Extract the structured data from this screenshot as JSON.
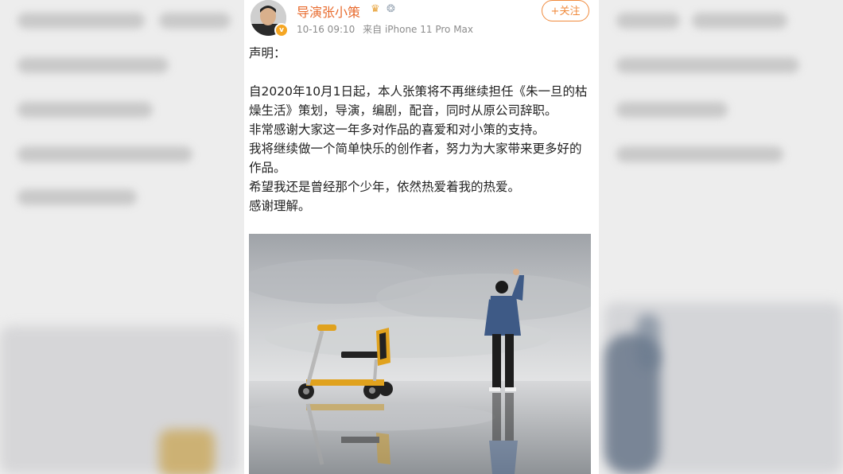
{
  "post": {
    "username": "导演张小策",
    "vip_icons": [
      "vip-crown-icon",
      "medal-icon"
    ],
    "timestamp": "10-16 09:10",
    "source_prefix": "来自",
    "device": "iPhone 11 Pro Max",
    "follow_label": "+关注",
    "verified_badge": "v",
    "body": {
      "heading": "声明：",
      "lines": [
        "自2020年10月1日起，本人张策将不再继续担任《朱一旦的枯燥生活》策划，导演，编剧，配音，同时从原公司辞职。",
        "非常感谢大家这一年多对作品的喜爱和对小策的支持。",
        "我将继续做一个简单快乐的创作者，努力为大家带来更多好的作品。",
        "希望我还是曾经那个少年，依然热爱着我的热爱。",
        "感谢理解。"
      ]
    }
  },
  "colors": {
    "username": "#e86b2e",
    "follow": "#f08a3c",
    "meta": "#8c8c8c",
    "text": "#222222",
    "badge": "#f5a623"
  }
}
